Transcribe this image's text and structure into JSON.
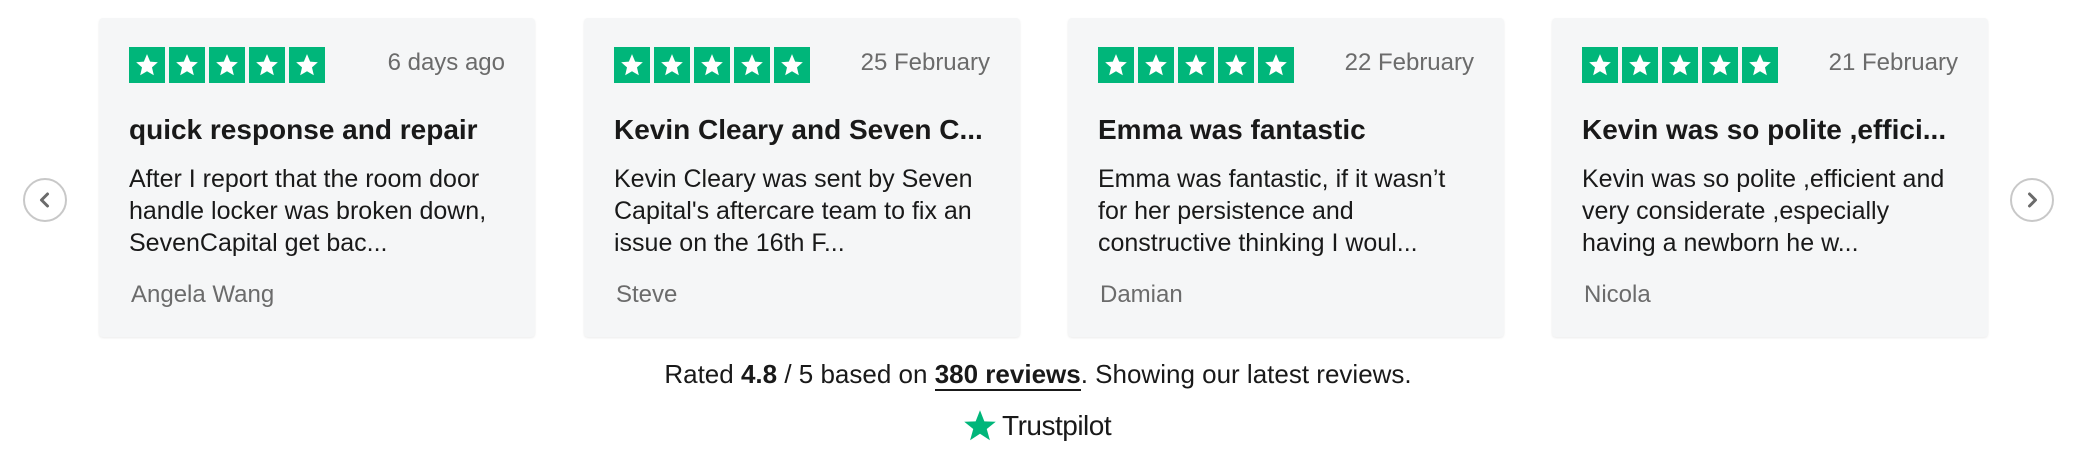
{
  "nav": {
    "prev_icon": "chevron-left-icon",
    "next_icon": "chevron-right-icon"
  },
  "rating_color": "#00b67a",
  "reviews": [
    {
      "stars": 5,
      "date": "6 days ago",
      "title": "quick response and repair",
      "body": "After I report that the room door handle locker was broken down, SevenCapital get bac...",
      "author": "Angela Wang"
    },
    {
      "stars": 5,
      "date": "25 February",
      "title": "Kevin Cleary and Seven C...",
      "body": "Kevin Cleary was sent by Seven Capital's aftercare team to fix an issue on the 16th F...",
      "author": "Steve"
    },
    {
      "stars": 5,
      "date": "22 February",
      "title": "Emma was fantastic",
      "body": "Emma was fantastic, if it wasn’t for her persistence and constructive thinking I woul...",
      "author": "Damian"
    },
    {
      "stars": 5,
      "date": "21 February",
      "title": "Kevin was so polite ,effici...",
      "body": "Kevin was so polite ,efficient and very considerate ,especially having a newborn he w...",
      "author": "Nicola"
    }
  ],
  "summary": {
    "prefix": "Rated",
    "score": "4.8",
    "scale": "/ 5 based on",
    "reviews_link": "380 reviews",
    "suffix": ". Showing our latest reviews."
  },
  "brand": {
    "name": "Trustpilot",
    "icon": "trustpilot-star-icon"
  }
}
